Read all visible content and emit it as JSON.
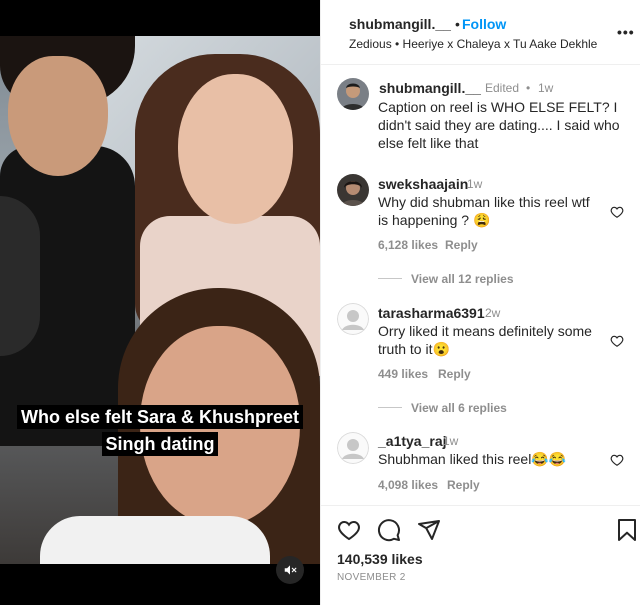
{
  "post": {
    "overlay_caption_line1": "Who else felt Sara & Khushpreet",
    "overlay_caption_line2": "Singh dating"
  },
  "header": {
    "username": "shubmangill.__",
    "separator": "•",
    "follow_label": "Follow",
    "audio": "Zedious • Heeriye x Chaleya x Tu Aake Dekhle"
  },
  "caption": {
    "username": "shubmangill.__",
    "edited": "Edited",
    "separator": "•",
    "time": "1w",
    "text": "Caption on reel is WHO ELSE FELT? I didn't said they are dating.... I said who else felt like that"
  },
  "comments": [
    {
      "username": "swekshaajain",
      "time": "1w",
      "text": "Why did shubman like this reel wtf is happening ? 😩",
      "likes": "6,128 likes",
      "reply_label": "Reply",
      "view_replies": "View all 12 replies"
    },
    {
      "username": "tarasharma6391",
      "time": "2w",
      "text": "Orry liked it means definitely some truth to it😮",
      "likes": "449 likes",
      "reply_label": "Reply",
      "view_replies": "View all 6 replies"
    },
    {
      "username": "_a1tya_raj",
      "time": "1w",
      "text": "Shubhman liked this reel😂😂",
      "likes": "4,098 likes",
      "reply_label": "Reply"
    }
  ],
  "footer": {
    "likes_total": "140,539 likes",
    "date": "NOVEMBER 2"
  },
  "icons": {
    "heart": "heart-icon",
    "comment": "comment-icon",
    "share": "share-icon",
    "save": "bookmark-icon",
    "mute": "muted-speaker-icon",
    "more": "more-icon"
  },
  "colors": {
    "accent": "#0095f6",
    "text": "#262626",
    "muted": "#8e8e8e"
  }
}
